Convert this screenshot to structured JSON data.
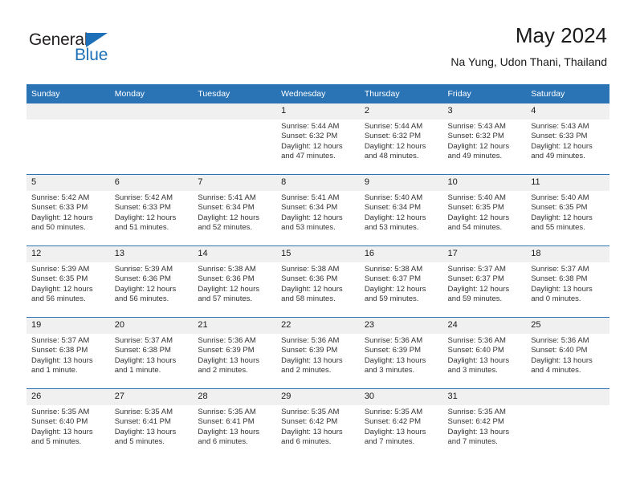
{
  "logo": {
    "word_top": "General",
    "word_bottom": "Blue",
    "triangle_color": "#1d70b8",
    "text_color": "#231f20"
  },
  "header": {
    "title": "May 2024",
    "subtitle": "Na Yung, Udon Thani, Thailand"
  },
  "theme": {
    "header_blue": "#2a74b6",
    "daynum_band": "#f0f0f0",
    "text": "#1a1a1a"
  },
  "weekday_headers": [
    "Sunday",
    "Monday",
    "Tuesday",
    "Wednesday",
    "Thursday",
    "Friday",
    "Saturday"
  ],
  "weeks": [
    [
      {
        "day": "",
        "sunrise": "",
        "sunset": "",
        "daylight1": "",
        "daylight2": "",
        "empty": true
      },
      {
        "day": "",
        "sunrise": "",
        "sunset": "",
        "daylight1": "",
        "daylight2": "",
        "empty": true
      },
      {
        "day": "",
        "sunrise": "",
        "sunset": "",
        "daylight1": "",
        "daylight2": "",
        "empty": true
      },
      {
        "day": "1",
        "sunrise": "Sunrise: 5:44 AM",
        "sunset": "Sunset: 6:32 PM",
        "daylight1": "Daylight: 12 hours",
        "daylight2": "and 47 minutes.",
        "empty": false
      },
      {
        "day": "2",
        "sunrise": "Sunrise: 5:44 AM",
        "sunset": "Sunset: 6:32 PM",
        "daylight1": "Daylight: 12 hours",
        "daylight2": "and 48 minutes.",
        "empty": false
      },
      {
        "day": "3",
        "sunrise": "Sunrise: 5:43 AM",
        "sunset": "Sunset: 6:32 PM",
        "daylight1": "Daylight: 12 hours",
        "daylight2": "and 49 minutes.",
        "empty": false
      },
      {
        "day": "4",
        "sunrise": "Sunrise: 5:43 AM",
        "sunset": "Sunset: 6:33 PM",
        "daylight1": "Daylight: 12 hours",
        "daylight2": "and 49 minutes.",
        "empty": false
      }
    ],
    [
      {
        "day": "5",
        "sunrise": "Sunrise: 5:42 AM",
        "sunset": "Sunset: 6:33 PM",
        "daylight1": "Daylight: 12 hours",
        "daylight2": "and 50 minutes.",
        "empty": false
      },
      {
        "day": "6",
        "sunrise": "Sunrise: 5:42 AM",
        "sunset": "Sunset: 6:33 PM",
        "daylight1": "Daylight: 12 hours",
        "daylight2": "and 51 minutes.",
        "empty": false
      },
      {
        "day": "7",
        "sunrise": "Sunrise: 5:41 AM",
        "sunset": "Sunset: 6:34 PM",
        "daylight1": "Daylight: 12 hours",
        "daylight2": "and 52 minutes.",
        "empty": false
      },
      {
        "day": "8",
        "sunrise": "Sunrise: 5:41 AM",
        "sunset": "Sunset: 6:34 PM",
        "daylight1": "Daylight: 12 hours",
        "daylight2": "and 53 minutes.",
        "empty": false
      },
      {
        "day": "9",
        "sunrise": "Sunrise: 5:40 AM",
        "sunset": "Sunset: 6:34 PM",
        "daylight1": "Daylight: 12 hours",
        "daylight2": "and 53 minutes.",
        "empty": false
      },
      {
        "day": "10",
        "sunrise": "Sunrise: 5:40 AM",
        "sunset": "Sunset: 6:35 PM",
        "daylight1": "Daylight: 12 hours",
        "daylight2": "and 54 minutes.",
        "empty": false
      },
      {
        "day": "11",
        "sunrise": "Sunrise: 5:40 AM",
        "sunset": "Sunset: 6:35 PM",
        "daylight1": "Daylight: 12 hours",
        "daylight2": "and 55 minutes.",
        "empty": false
      }
    ],
    [
      {
        "day": "12",
        "sunrise": "Sunrise: 5:39 AM",
        "sunset": "Sunset: 6:35 PM",
        "daylight1": "Daylight: 12 hours",
        "daylight2": "and 56 minutes.",
        "empty": false
      },
      {
        "day": "13",
        "sunrise": "Sunrise: 5:39 AM",
        "sunset": "Sunset: 6:36 PM",
        "daylight1": "Daylight: 12 hours",
        "daylight2": "and 56 minutes.",
        "empty": false
      },
      {
        "day": "14",
        "sunrise": "Sunrise: 5:38 AM",
        "sunset": "Sunset: 6:36 PM",
        "daylight1": "Daylight: 12 hours",
        "daylight2": "and 57 minutes.",
        "empty": false
      },
      {
        "day": "15",
        "sunrise": "Sunrise: 5:38 AM",
        "sunset": "Sunset: 6:36 PM",
        "daylight1": "Daylight: 12 hours",
        "daylight2": "and 58 minutes.",
        "empty": false
      },
      {
        "day": "16",
        "sunrise": "Sunrise: 5:38 AM",
        "sunset": "Sunset: 6:37 PM",
        "daylight1": "Daylight: 12 hours",
        "daylight2": "and 59 minutes.",
        "empty": false
      },
      {
        "day": "17",
        "sunrise": "Sunrise: 5:37 AM",
        "sunset": "Sunset: 6:37 PM",
        "daylight1": "Daylight: 12 hours",
        "daylight2": "and 59 minutes.",
        "empty": false
      },
      {
        "day": "18",
        "sunrise": "Sunrise: 5:37 AM",
        "sunset": "Sunset: 6:38 PM",
        "daylight1": "Daylight: 13 hours",
        "daylight2": "and 0 minutes.",
        "empty": false
      }
    ],
    [
      {
        "day": "19",
        "sunrise": "Sunrise: 5:37 AM",
        "sunset": "Sunset: 6:38 PM",
        "daylight1": "Daylight: 13 hours",
        "daylight2": "and 1 minute.",
        "empty": false
      },
      {
        "day": "20",
        "sunrise": "Sunrise: 5:37 AM",
        "sunset": "Sunset: 6:38 PM",
        "daylight1": "Daylight: 13 hours",
        "daylight2": "and 1 minute.",
        "empty": false
      },
      {
        "day": "21",
        "sunrise": "Sunrise: 5:36 AM",
        "sunset": "Sunset: 6:39 PM",
        "daylight1": "Daylight: 13 hours",
        "daylight2": "and 2 minutes.",
        "empty": false
      },
      {
        "day": "22",
        "sunrise": "Sunrise: 5:36 AM",
        "sunset": "Sunset: 6:39 PM",
        "daylight1": "Daylight: 13 hours",
        "daylight2": "and 2 minutes.",
        "empty": false
      },
      {
        "day": "23",
        "sunrise": "Sunrise: 5:36 AM",
        "sunset": "Sunset: 6:39 PM",
        "daylight1": "Daylight: 13 hours",
        "daylight2": "and 3 minutes.",
        "empty": false
      },
      {
        "day": "24",
        "sunrise": "Sunrise: 5:36 AM",
        "sunset": "Sunset: 6:40 PM",
        "daylight1": "Daylight: 13 hours",
        "daylight2": "and 3 minutes.",
        "empty": false
      },
      {
        "day": "25",
        "sunrise": "Sunrise: 5:36 AM",
        "sunset": "Sunset: 6:40 PM",
        "daylight1": "Daylight: 13 hours",
        "daylight2": "and 4 minutes.",
        "empty": false
      }
    ],
    [
      {
        "day": "26",
        "sunrise": "Sunrise: 5:35 AM",
        "sunset": "Sunset: 6:40 PM",
        "daylight1": "Daylight: 13 hours",
        "daylight2": "and 5 minutes.",
        "empty": false
      },
      {
        "day": "27",
        "sunrise": "Sunrise: 5:35 AM",
        "sunset": "Sunset: 6:41 PM",
        "daylight1": "Daylight: 13 hours",
        "daylight2": "and 5 minutes.",
        "empty": false
      },
      {
        "day": "28",
        "sunrise": "Sunrise: 5:35 AM",
        "sunset": "Sunset: 6:41 PM",
        "daylight1": "Daylight: 13 hours",
        "daylight2": "and 6 minutes.",
        "empty": false
      },
      {
        "day": "29",
        "sunrise": "Sunrise: 5:35 AM",
        "sunset": "Sunset: 6:42 PM",
        "daylight1": "Daylight: 13 hours",
        "daylight2": "and 6 minutes.",
        "empty": false
      },
      {
        "day": "30",
        "sunrise": "Sunrise: 5:35 AM",
        "sunset": "Sunset: 6:42 PM",
        "daylight1": "Daylight: 13 hours",
        "daylight2": "and 7 minutes.",
        "empty": false
      },
      {
        "day": "31",
        "sunrise": "Sunrise: 5:35 AM",
        "sunset": "Sunset: 6:42 PM",
        "daylight1": "Daylight: 13 hours",
        "daylight2": "and 7 minutes.",
        "empty": false
      },
      {
        "day": "",
        "sunrise": "",
        "sunset": "",
        "daylight1": "",
        "daylight2": "",
        "empty": true
      }
    ]
  ]
}
